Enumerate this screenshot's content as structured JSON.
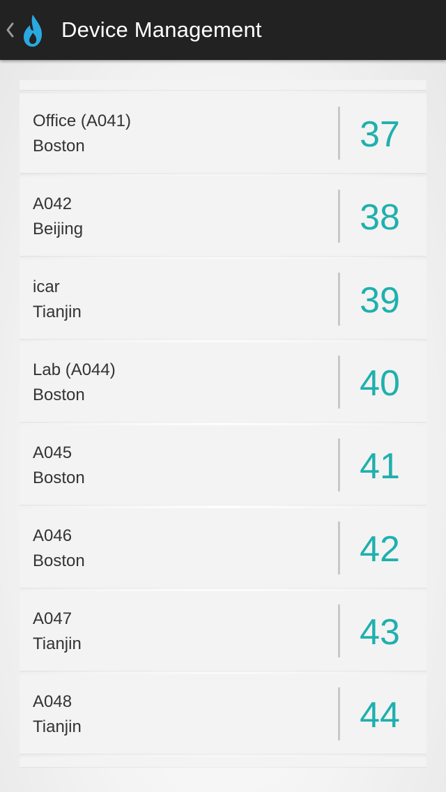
{
  "action_bar": {
    "title": "Device Management",
    "back_icon": "chevron-left-icon",
    "logo_icon": "flame-logo-icon",
    "background_color": "#222222",
    "logo_color": "#29a9e0"
  },
  "devices": [
    {
      "name": "Office (A041)",
      "city": "Boston",
      "number": "37"
    },
    {
      "name": "A042",
      "city": "Beijing",
      "number": "38"
    },
    {
      "name": "icar",
      "city": "Tianjin",
      "number": "39"
    },
    {
      "name": "Lab (A044)",
      "city": "Boston",
      "number": "40"
    },
    {
      "name": "A045",
      "city": "Boston",
      "number": "41"
    },
    {
      "name": "A046",
      "city": "Boston",
      "number": "42"
    },
    {
      "name": "A047",
      "city": "Tianjin",
      "number": "43"
    },
    {
      "name": "A048",
      "city": "Tianjin",
      "number": "44"
    }
  ],
  "colors": {
    "accent": "#1fb0ae",
    "text": "#333333",
    "card": "#f3f3f3"
  }
}
